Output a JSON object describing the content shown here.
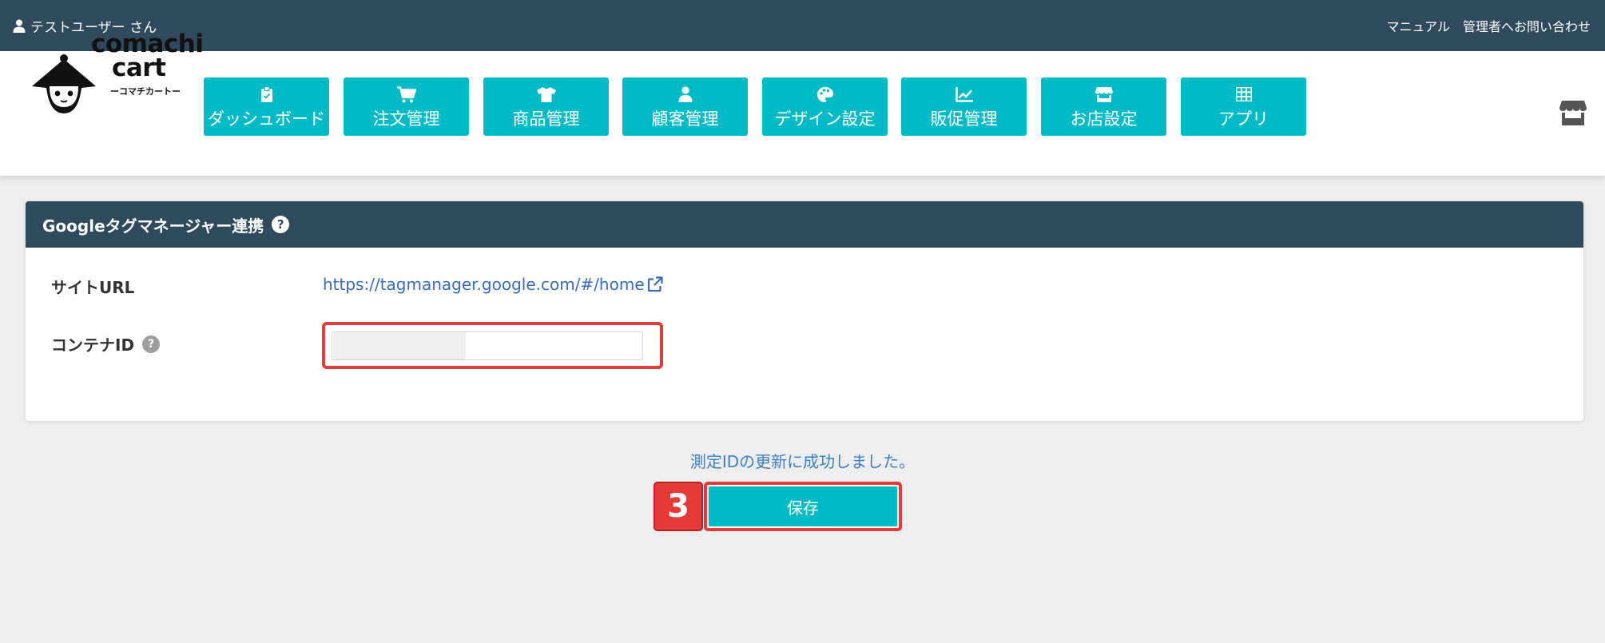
{
  "topbar": {
    "user_label": "テストユーザー さん",
    "links": [
      "マニュアル",
      "管理者へお問い合わせ"
    ]
  },
  "logo": {
    "line1": "comachi",
    "line2": "cart",
    "line3": "ーコマチカートー"
  },
  "nav": [
    {
      "label": "ダッシュボード",
      "icon": "clipboard-icon"
    },
    {
      "label": "注文管理",
      "icon": "cart-icon"
    },
    {
      "label": "商品管理",
      "icon": "tshirt-icon"
    },
    {
      "label": "顧客管理",
      "icon": "user-icon"
    },
    {
      "label": "デザイン設定",
      "icon": "palette-icon"
    },
    {
      "label": "販促管理",
      "icon": "chart-line-icon"
    },
    {
      "label": "お店設定",
      "icon": "store-icon"
    },
    {
      "label": "アプリ",
      "icon": "grid-icon"
    }
  ],
  "panel": {
    "title": "Googleタグマネージャー連携",
    "site_url_label": "サイトURL",
    "site_url": "https://tagmanager.google.com/#/home",
    "container_id_label": "コンテナID",
    "container_id_value": ""
  },
  "status": {
    "message": "測定IDの更新に成功しました。"
  },
  "actions": {
    "step_number": "3",
    "save_label": "保存"
  },
  "colors": {
    "topbar": "#2f4a5d",
    "accent": "#00bbc6",
    "highlight": "#e53a3a",
    "link": "#3a6bbd"
  }
}
